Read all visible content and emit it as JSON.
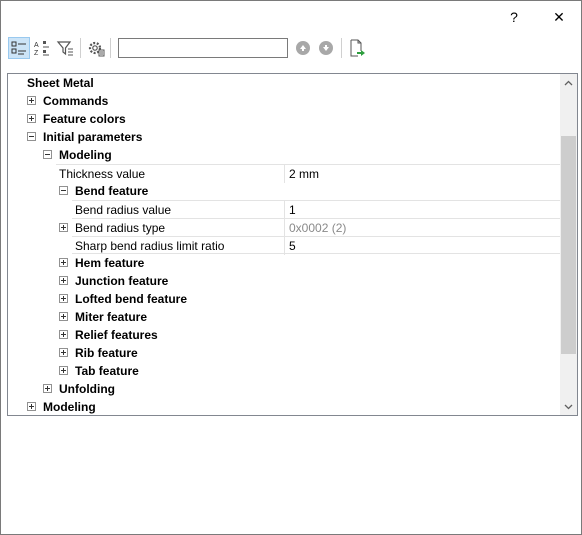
{
  "titlebar": {
    "help_label": "?",
    "close_label": "✕"
  },
  "toolbar": {
    "search": {
      "value": "",
      "placeholder": ""
    },
    "az_top": "A",
    "az_bottom": "Z",
    "az_top2": "Z",
    "az_bottom2": "A"
  },
  "tree": {
    "root": "Sheet Metal",
    "commands": "Commands",
    "feature_colors": "Feature colors",
    "initial_parameters": "Initial parameters",
    "modeling_group": "Modeling",
    "thickness": {
      "name": "Thickness value",
      "value": "2 mm"
    },
    "bend_feature": "Bend feature",
    "bend_radius": {
      "name": "Bend radius value",
      "value": "1"
    },
    "bend_radius_type": {
      "name": "Bend radius type",
      "value": "0x0002 (2)"
    },
    "sharp_bend": {
      "name": "Sharp bend radius limit ratio",
      "value": "5"
    },
    "hem_feature": "Hem feature",
    "junction_feature": "Junction feature",
    "lofted_bend_feature": "Lofted bend feature",
    "miter_feature": "Miter feature",
    "relief_features": "Relief features",
    "rib_feature": "Rib feature",
    "tab_feature": "Tab feature",
    "unfolding": "Unfolding",
    "modeling_root": "Modeling"
  }
}
